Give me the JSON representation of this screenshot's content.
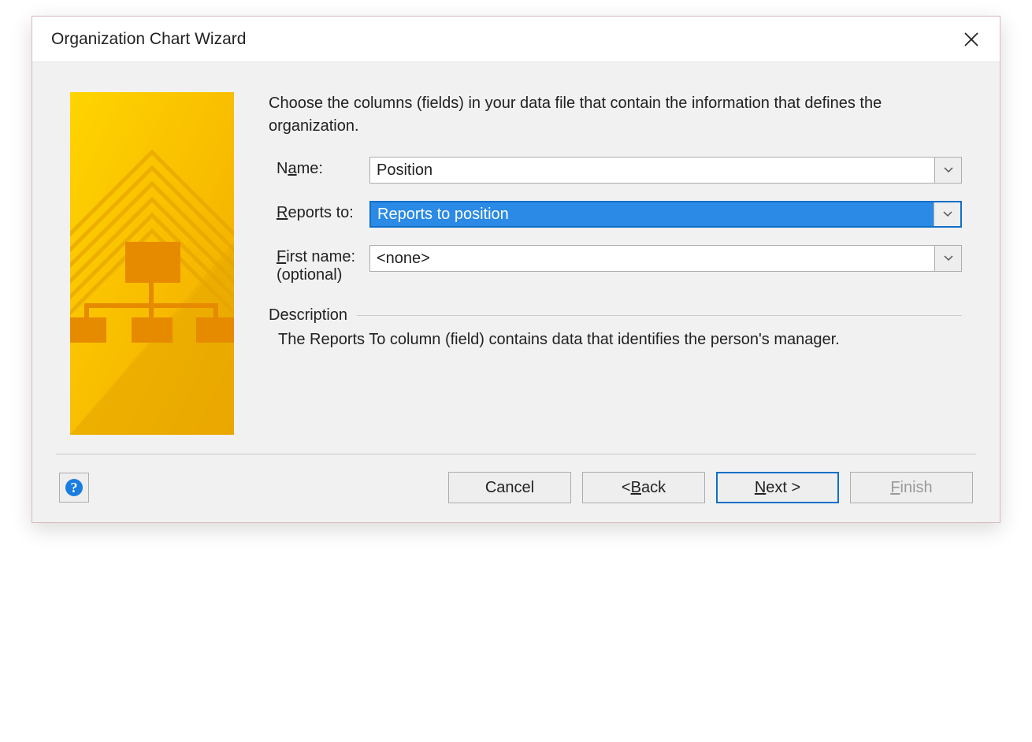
{
  "titlebar": {
    "title": "Organization Chart Wizard"
  },
  "intro": "Choose the columns (fields) in your data file that contain the information that defines the organization.",
  "fields": {
    "name": {
      "label_pre": "N",
      "label_u": "a",
      "label_post": "me:",
      "value": "Position"
    },
    "reports_to": {
      "label_u": "R",
      "label_post": "eports to:",
      "value": "Reports to position"
    },
    "first_name": {
      "label_u": "F",
      "label_post": "irst name:",
      "optional": "(optional)",
      "value": "<none>"
    }
  },
  "description": {
    "label": "Description",
    "text": "The Reports To column (field) contains data that identifies the person's manager."
  },
  "buttons": {
    "cancel": "Cancel",
    "back_pre": "< ",
    "back_u": "B",
    "back_post": "ack",
    "next_u": "N",
    "next_post": "ext >",
    "finish_u": "F",
    "finish_post": "inish"
  }
}
